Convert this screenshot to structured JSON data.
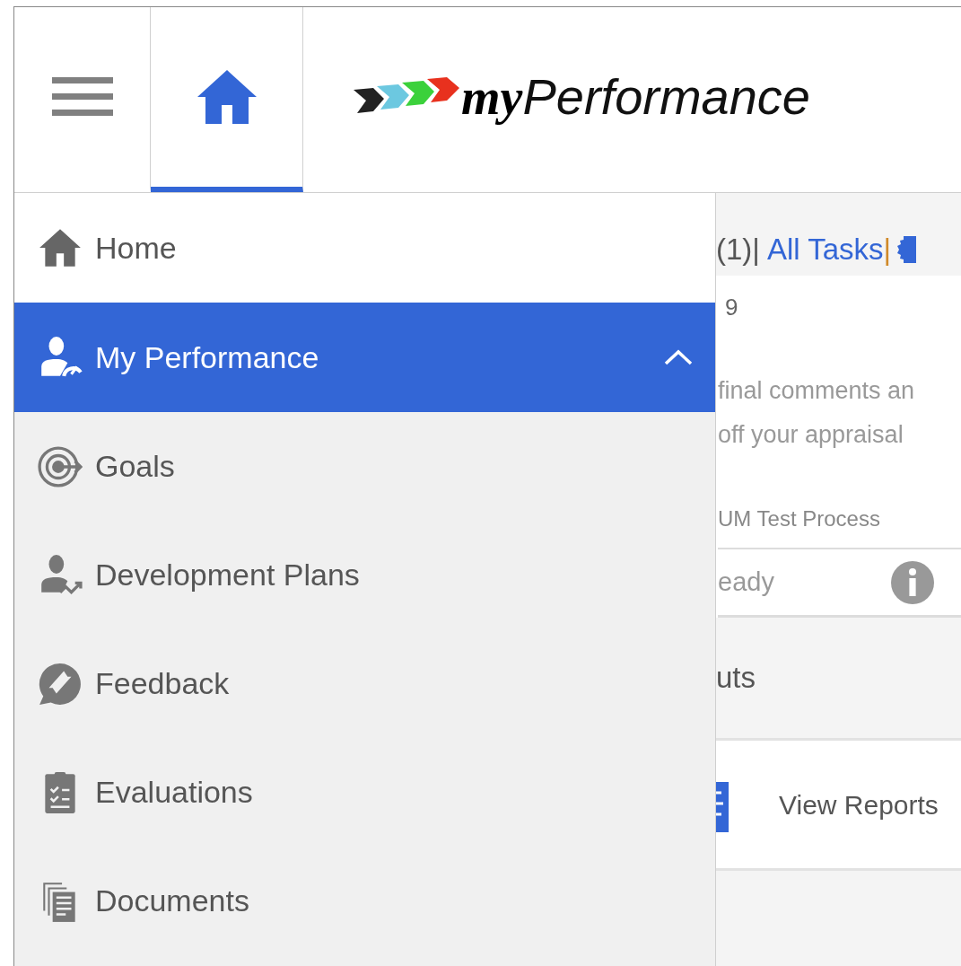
{
  "header": {
    "nav_tabs": [
      {
        "kind": "menu",
        "selected": false
      },
      {
        "kind": "home",
        "selected": true
      }
    ],
    "logo": {
      "bold": "my",
      "light": "Performance"
    }
  },
  "sidebar": {
    "items": [
      {
        "kind": "home",
        "label": "Home",
        "selected": false
      },
      {
        "kind": "performance",
        "label": "My Performance",
        "selected": true,
        "expanded": true,
        "children": [
          {
            "kind": "goals",
            "label": "Goals"
          },
          {
            "kind": "development",
            "label": "Development Plans"
          },
          {
            "kind": "feedback",
            "label": "Feedback"
          },
          {
            "kind": "evaluations",
            "label": "Evaluations"
          },
          {
            "kind": "documents",
            "label": "Documents"
          }
        ]
      }
    ]
  },
  "main": {
    "task_bar": {
      "count": "(1)|",
      "link": "All Tasks",
      "separator": "|"
    },
    "task": {
      "date": "9",
      "message": "final comments an off your appraisal",
      "process": "UM Test Process",
      "status": "eady"
    },
    "shortcuts": {
      "title": "uts",
      "items": [
        {
          "label": "View Reports"
        }
      ]
    }
  }
}
